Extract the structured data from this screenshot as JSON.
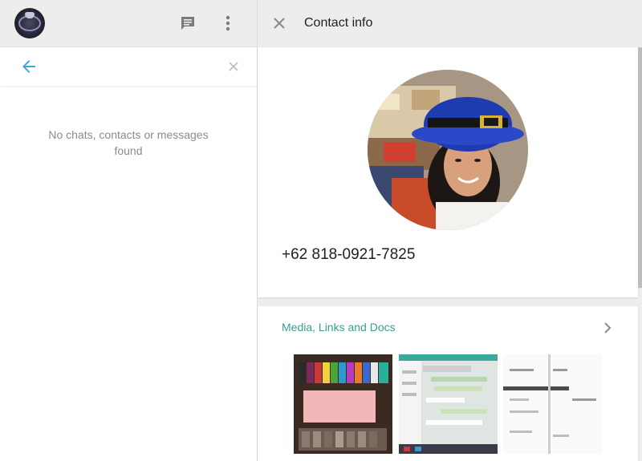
{
  "left_header": {
    "avatar_icon": "profile-avatar",
    "new_chat_icon": "new-chat-icon",
    "menu_icon": "more-vert-icon"
  },
  "search": {
    "back_icon": "arrow-back-icon",
    "value": "",
    "placeholder": "",
    "clear_icon": "close-icon"
  },
  "chat_list": {
    "empty_line1": "No chats, contacts or messages",
    "empty_line2": "found"
  },
  "contact_panel": {
    "close_icon": "close-icon",
    "title": "Contact info",
    "phone": "+62 818-0921-7825",
    "media_label": "Media, Links and Docs",
    "media_icon": "chevron-right-icon"
  },
  "colors": {
    "accent": "#3b9c94",
    "back_arrow": "#42a5d9",
    "panel_bg": "#ededed",
    "icon": "#7a7a7a"
  }
}
